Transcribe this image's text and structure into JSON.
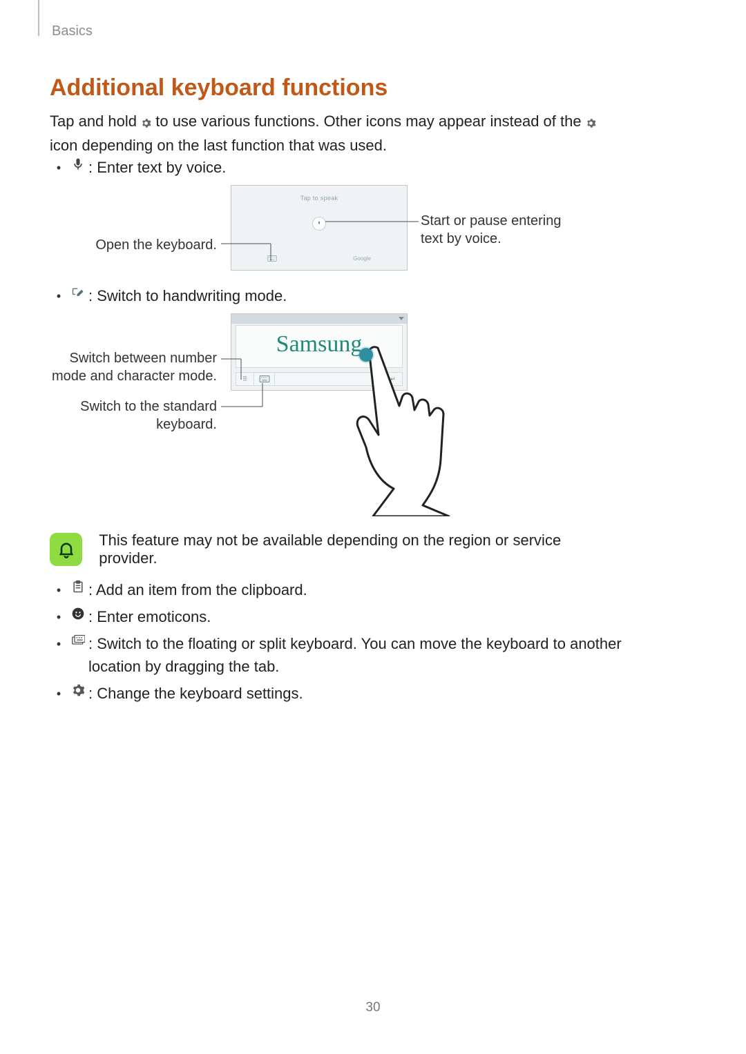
{
  "section_label": "Basics",
  "heading": "Additional keyboard functions",
  "intro_parts": {
    "a": "Tap and hold ",
    "b": " to use various functions. Other icons may appear instead of the ",
    "c": " icon depending on the last function that was used."
  },
  "bullets": {
    "voice": " : Enter text by voice.",
    "handwriting": " : Switch to handwriting mode.",
    "clipboard": " : Add an item from the clipboard.",
    "emoticons": " : Enter emoticons.",
    "floating": " : Switch to the floating or split keyboard. You can move the keyboard to another location by dragging the tab.",
    "settings": " : Change the keyboard settings."
  },
  "callouts": {
    "open_keyboard": "Open the keyboard.",
    "start_pause_voice": "Start or pause entering text by voice.",
    "switch_num_char_1": "Switch between number",
    "switch_num_char_2": "mode and character mode.",
    "switch_standard_1": "Switch to the standard",
    "switch_standard_2": "keyboard."
  },
  "voice_panel": {
    "tap_to_speak": "Tap to speak",
    "left_btn": "",
    "right_btn": "Google"
  },
  "hw_panel": {
    "written_text": "Samsung",
    "btn_mode": "⠿",
    "btn_kb": "⌨",
    "btn_enter": "↵"
  },
  "note_text": "This feature may not be available depending on the region or service provider.",
  "page_number": "30"
}
